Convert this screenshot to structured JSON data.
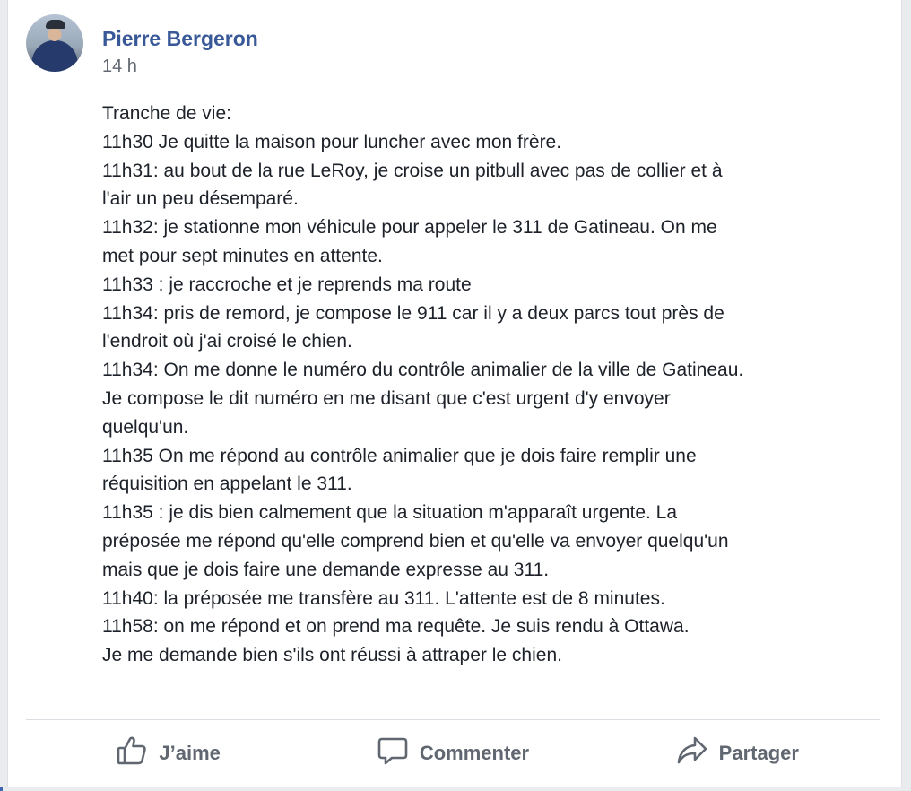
{
  "post": {
    "author": "Pierre Bergeron",
    "timestamp": "14 h",
    "lines": [
      "Tranche de vie:",
      "11h30 Je quitte la maison pour luncher avec mon frère.",
      "11h31: au bout de la rue LeRoy, je croise un pitbull avec pas de collier et à",
      "l'air un peu désemparé.",
      "11h32: je stationne mon véhicule pour appeler le 311 de Gatineau. On me",
      "met pour sept minutes en attente.",
      "11h33 : je raccroche et je reprends ma route",
      "11h34: pris de remord, je compose le 911 car il y a deux parcs tout près de",
      "l'endroit où j'ai croisé le chien.",
      "11h34: On me donne le numéro du contrôle animalier de la ville de Gatineau.",
      "Je compose le dit numéro en me disant que c'est urgent d'y envoyer",
      "quelqu'un.",
      "11h35 On me répond au contrôle animalier que je dois faire remplir une",
      "réquisition en appelant le 311.",
      "11h35 : je dis bien calmement que la situation m'apparaît urgente. La",
      "préposée me répond qu'elle comprend bien et qu'elle va envoyer quelqu'un",
      "mais que je dois faire une demande expresse au 311.",
      "11h40: la préposée me transfère au 311. L'attente est de 8 minutes.",
      "11h58: on me répond et on prend ma requête. Je suis rendu à Ottawa.",
      "Je me demande bien s'ils ont réussi à attraper le chien."
    ]
  },
  "actions": {
    "like_label": "J’aime",
    "comment_label": "Commenter",
    "share_label": "Partager",
    "like_icon": "thumbs-up-icon",
    "comment_icon": "speech-bubble-icon",
    "share_icon": "share-arrow-icon"
  },
  "colors": {
    "author_link": "#385898",
    "text": "#1d2129",
    "muted": "#606770"
  }
}
